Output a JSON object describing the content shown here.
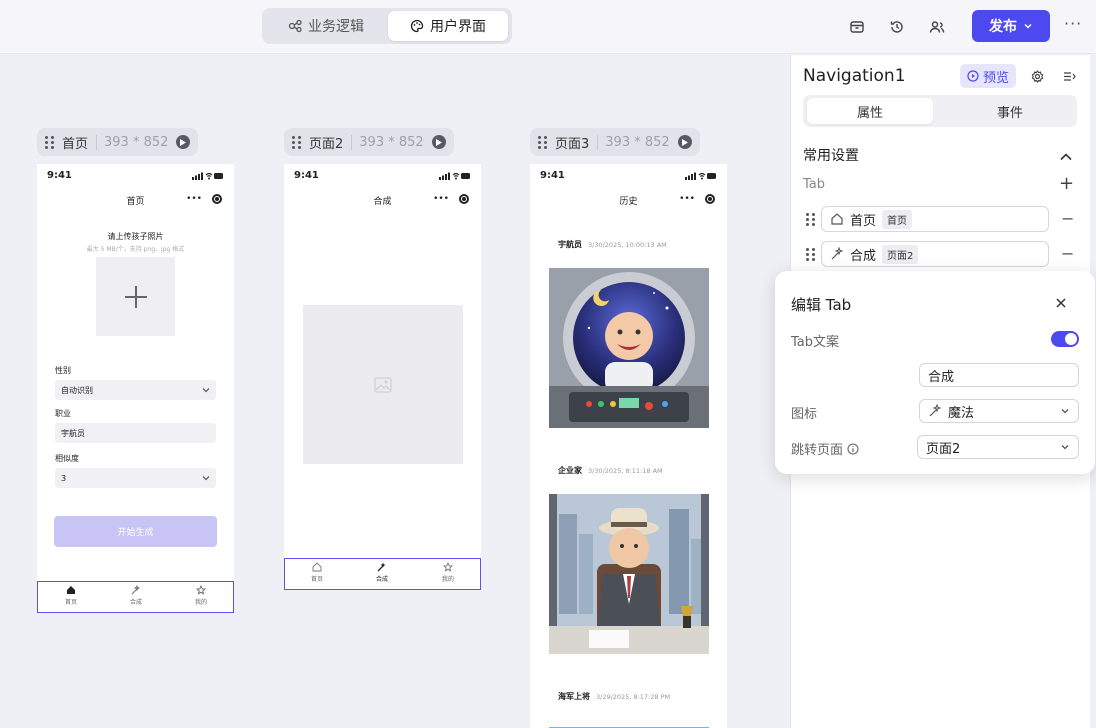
{
  "topbar": {
    "tab_logic": "业务逻辑",
    "tab_ui": "用户界面",
    "publish": "发布"
  },
  "frames": [
    {
      "name": "首页",
      "size": "393 * 852"
    },
    {
      "name": "页面2",
      "size": "393 * 852"
    },
    {
      "name": "页面3",
      "size": "393 * 852"
    }
  ],
  "status_time": "9:41",
  "page1": {
    "title": "首页",
    "upload_title": "请上传孩子照片",
    "upload_hint": "最大 5 MB/个，支持 png、jpg 格式",
    "gender_label": "性别",
    "gender_value": "自动识别",
    "job_label": "职业",
    "job_value": "宇航员",
    "similarity_label": "相似度",
    "similarity_value": "3",
    "generate_button": "开始生成"
  },
  "page2": {
    "title": "合成"
  },
  "page3": {
    "title": "历史",
    "items": [
      {
        "name": "宇航员",
        "time": "3/30/2025, 10:00:13 AM"
      },
      {
        "name": "企业家",
        "time": "3/30/2025, 8:11:18 AM"
      },
      {
        "name": "海军上将",
        "time": "3/29/2025, 8:17:28 PM"
      }
    ]
  },
  "tabbar": [
    "首页",
    "合成",
    "我的"
  ],
  "panel": {
    "title": "Navigation1",
    "preview": "预览",
    "tab_props": "属性",
    "tab_events": "事件",
    "section": "常用设置",
    "tab_label": "Tab",
    "tabs": [
      {
        "label": "首页",
        "page": "首页",
        "icon": "home-icon"
      },
      {
        "label": "合成",
        "page": "页面2",
        "icon": "magic-icon"
      }
    ]
  },
  "popover": {
    "title": "编辑 Tab",
    "text_label": "Tab文案",
    "text_value": "合成",
    "icon_label": "图标",
    "icon_value": "魔法",
    "jump_label": "跳转页面",
    "jump_value": "页面2",
    "toggle_on": true
  },
  "colors": {
    "accent": "#4d49f0",
    "accent_light": "#c9c4f6",
    "canvas": "#efeff6"
  }
}
